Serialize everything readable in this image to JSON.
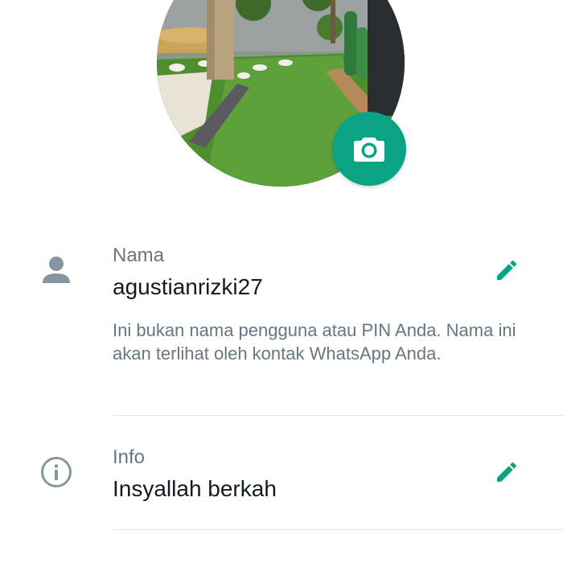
{
  "profile": {
    "photo_alt": "garden",
    "camera_icon": "camera-icon",
    "accent_color": "#0aa384"
  },
  "name_row": {
    "icon": "person-icon",
    "label": "Nama",
    "value": "agustianrizki27",
    "hint": "Ini bukan nama pengguna atau PIN Anda. Nama ini akan terlihat oleh kontak WhatsApp Anda.",
    "edit_icon": "pencil-icon"
  },
  "about_row": {
    "icon": "info-icon",
    "label": "Info",
    "value": "Insyallah berkah",
    "edit_icon": "pencil-icon"
  }
}
